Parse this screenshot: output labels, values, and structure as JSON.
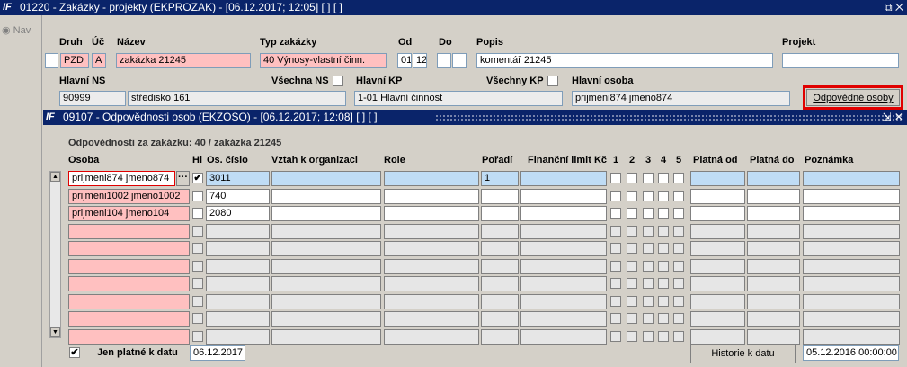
{
  "window": {
    "title": "01220 - Zakázky - projekty (EKPROZAK) - [06.12.2017; 12:05] [ ] [ ]",
    "controls": "⧉ ✕"
  },
  "side": {
    "nav_label": "Nav"
  },
  "header": {
    "labels": {
      "druh": "Druh",
      "uc": "Úč",
      "nazev": "Název",
      "typ": "Typ zakázky",
      "od": "Od",
      "do": "Do",
      "popis": "Popis",
      "projekt": "Projekt",
      "hlavni_ns": "Hlavní NS",
      "vsechna_ns": "Všechna NS",
      "hlavni_kp": "Hlavní KP",
      "vsechny_kp": "Všechny KP",
      "hlavni_osoba": "Hlavní osoba"
    },
    "values": {
      "druh": "PZD",
      "uc": "A",
      "nazev": "zakázka 21245",
      "typ": "40 Výnosy-vlastní činn.",
      "od1": "01",
      "od2": "12",
      "popis": "komentář 21245",
      "projekt": "",
      "ns_code": "90999",
      "ns_name": "středisko 161",
      "kp": "1-01 Hlavní činnost",
      "osoba": "prijmeni874 jmeno874"
    },
    "button_odpovedne": "Odpovědné osoby"
  },
  "sub": {
    "title": "09107 - Odpovědnosti osob (EKZOSO) - [06.12.2017; 12:08] [ ] [ ]",
    "controls": "⇲ ✕",
    "heading": "Odpovědnosti za zakázku: 40 / zakázka 21245",
    "columns": {
      "osoba": "Osoba",
      "hl": "Hl",
      "os_cislo": "Os. číslo",
      "vztah": "Vztah k organizaci",
      "role": "Role",
      "poradi": "Pořadí",
      "limit": "Finanční limit Kč",
      "c1": "1",
      "c2": "2",
      "c3": "3",
      "c4": "4",
      "c5": "5",
      "platna_od": "Platná od",
      "platna_do": "Platná do",
      "poznamka": "Poznámka"
    },
    "rows": [
      {
        "osoba": "prijmeni874 jmeno874",
        "hl": "✔",
        "os_cislo": "3011",
        "poradi": "1"
      },
      {
        "osoba": "prijmeni1002 jmeno1002",
        "hl": "",
        "os_cislo": "740",
        "poradi": ""
      },
      {
        "osoba": "prijmeni104 jmeno104",
        "hl": "",
        "os_cislo": "2080",
        "poradi": ""
      }
    ],
    "footer": {
      "jen_platne_label": "Jen platné k datu",
      "jen_platne_checked": "✔",
      "date": "06.12.2017",
      "historie_button": "Historie k datu",
      "historie_datetime": "05.12.2016 00:00:00"
    }
  }
}
